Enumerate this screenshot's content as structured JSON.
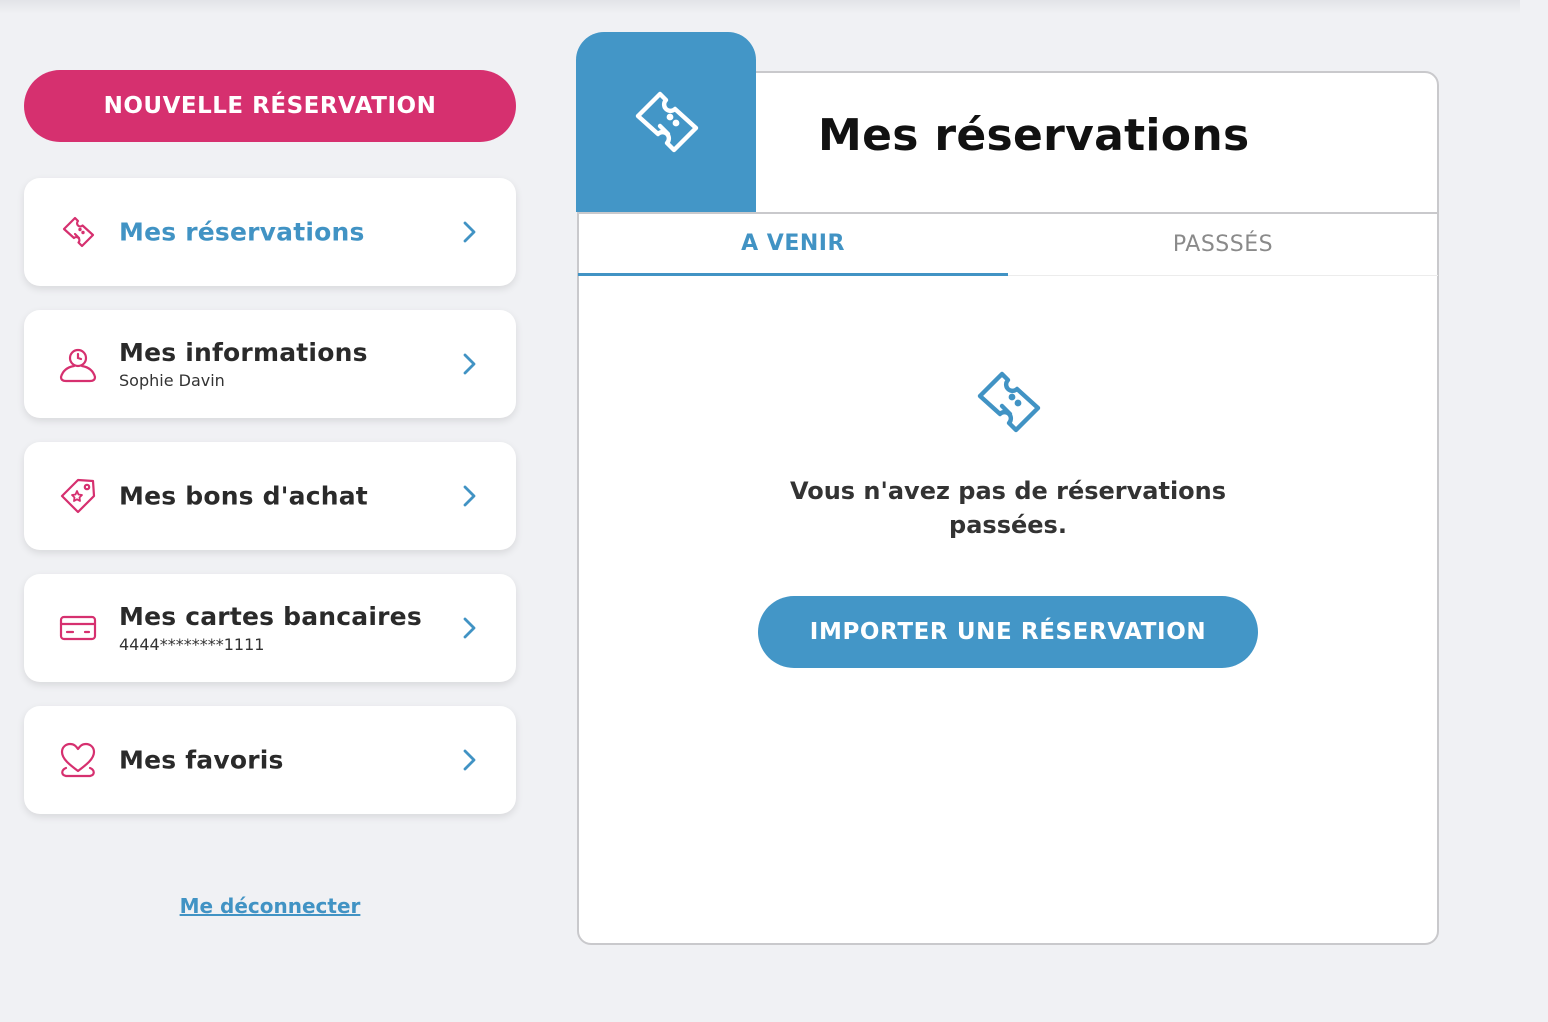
{
  "sidebar": {
    "new_reservation_label": "NOUVELLE RÉSERVATION",
    "items": [
      {
        "label": "Mes réservations",
        "sub": "",
        "icon": "ticket-icon",
        "active": true
      },
      {
        "label": "Mes informations",
        "sub": "Sophie Davin",
        "icon": "user-icon",
        "active": false
      },
      {
        "label": "Mes bons d'achat",
        "sub": "",
        "icon": "voucher-tag-icon",
        "active": false
      },
      {
        "label": "Mes cartes bancaires",
        "sub": "4444********1111",
        "icon": "credit-card-icon",
        "active": false
      },
      {
        "label": "Mes favoris",
        "sub": "",
        "icon": "heart-icon",
        "active": false
      }
    ],
    "logout_label": "Me déconnecter"
  },
  "main": {
    "title": "Mes réservations",
    "header_icon": "ticket-icon",
    "tabs": [
      {
        "label": "A VENIR",
        "active": true
      },
      {
        "label": "PASSSÉS",
        "active": false
      }
    ],
    "empty_icon": "ticket-icon",
    "empty_message": "Vous n'avez pas de réservations passées.",
    "import_button_label": "IMPORTER UNE RÉSERVATION"
  },
  "colors": {
    "accent_pink": "#d6306f",
    "accent_blue": "#4193c4",
    "background": "#f0f1f4"
  }
}
